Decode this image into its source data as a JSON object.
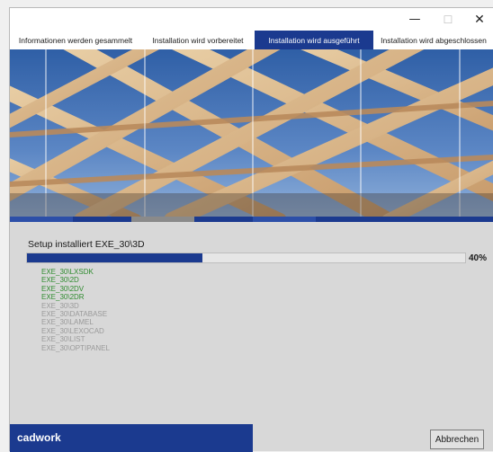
{
  "window": {
    "controls": {
      "minimize": "—",
      "maximize": "☐",
      "close": "✕"
    }
  },
  "tabs": [
    {
      "label": "Informationen werden gesammelt",
      "active": false
    },
    {
      "label": "Installation wird vorbereitet",
      "active": false
    },
    {
      "label": "Installation wird ausgeführt",
      "active": true
    },
    {
      "label": "Installation wird abgeschlossen",
      "active": false
    }
  ],
  "banner": {
    "icon": "timber-roof-photo"
  },
  "status": {
    "text": "Setup installiert EXE_30\\3D",
    "progress_fraction": 0.4,
    "percent_label": "40%"
  },
  "modules": [
    {
      "name": "EXE_30\\LXSDK",
      "state": "done"
    },
    {
      "name": "EXE_30\\2D",
      "state": "done"
    },
    {
      "name": "EXE_30\\2DV",
      "state": "done"
    },
    {
      "name": "EXE_30\\2DR",
      "state": "done"
    },
    {
      "name": "EXE_30\\3D",
      "state": "pending"
    },
    {
      "name": "EXE_30\\DATABASE",
      "state": "pending"
    },
    {
      "name": "EXE_30\\LAMEL",
      "state": "pending"
    },
    {
      "name": "EXE_30\\LEXOCAD",
      "state": "pending"
    },
    {
      "name": "EXE_30\\LIST",
      "state": "pending"
    },
    {
      "name": "EXE_30\\OPTIPANEL",
      "state": "pending"
    }
  ],
  "brand": {
    "name": "cadwork"
  },
  "buttons": {
    "cancel": "Abbrechen"
  },
  "colors": {
    "accent": "#1b3a8f",
    "done_text": "#2e8b2e",
    "pending_text": "#9a9a9a"
  }
}
